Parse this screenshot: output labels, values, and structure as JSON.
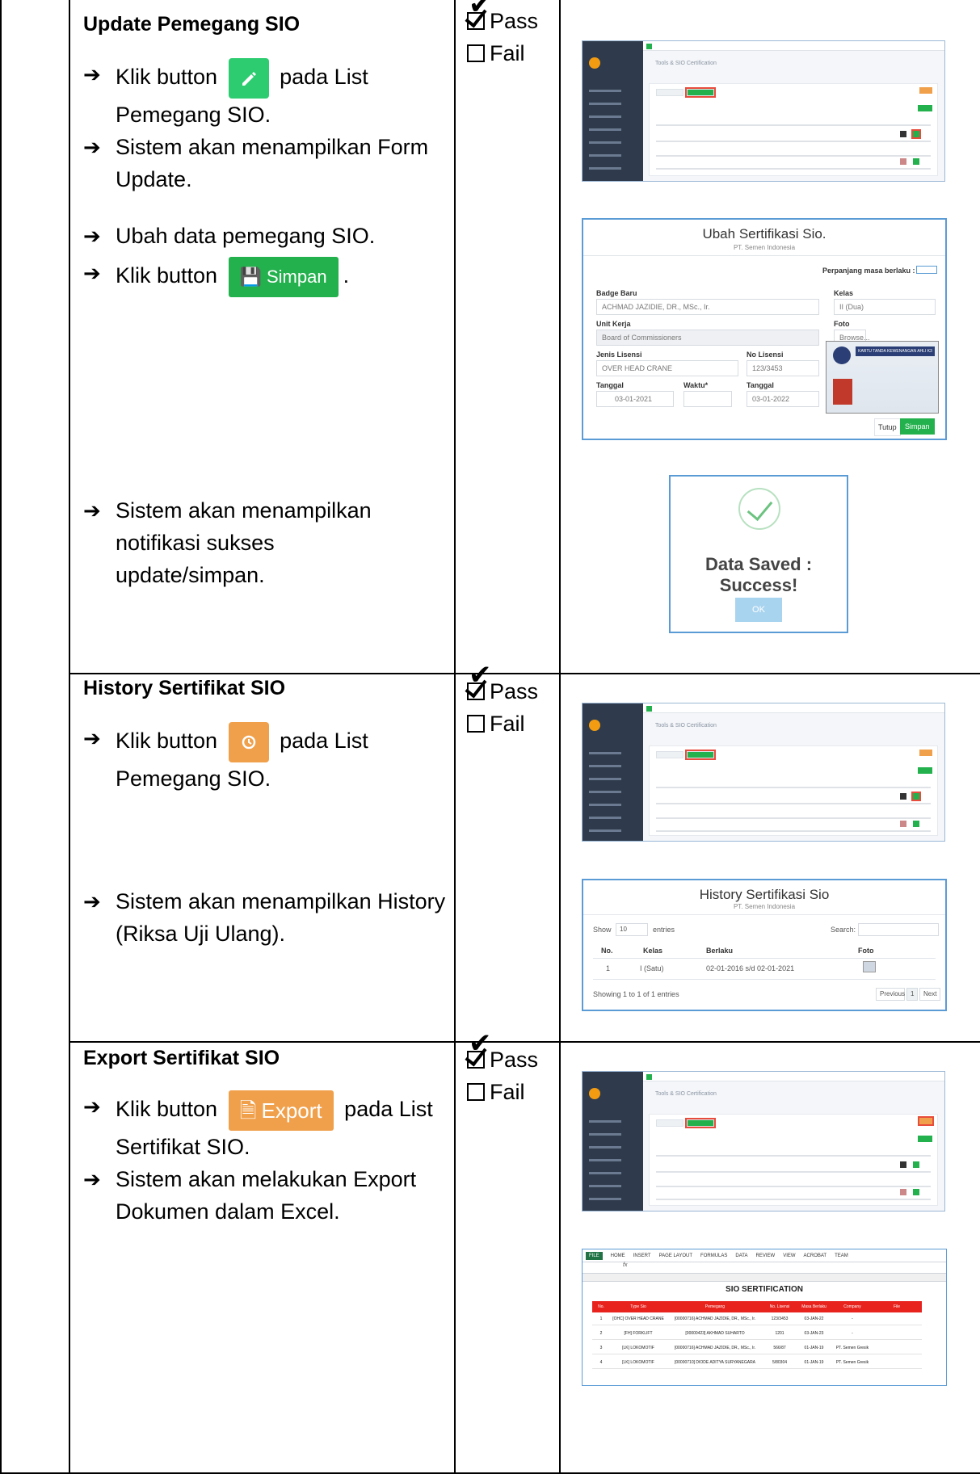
{
  "rows": [
    {
      "title": "Update Pemegang SIO",
      "steps": [
        {
          "pre": "Klik button",
          "post": "pada List Pemegang SIO."
        },
        {
          "text": "Sistem akan menampilkan Form Update."
        },
        {
          "text": "Ubah data pemegang SIO."
        },
        {
          "pre": "Klik button",
          "post": "."
        },
        {
          "text": "Sistem akan menampilkan notifikasi sukses update/simpan."
        }
      ],
      "pass_label": "Pass",
      "fail_label": "Fail",
      "pass_checked": true
    },
    {
      "title": "History Sertifikat SIO",
      "steps": [
        {
          "pre": "Klik button",
          "post": "pada List Pemegang SIO."
        },
        {
          "text": "Sistem akan menampilkan History (Riksa Uji Ulang)."
        }
      ],
      "pass_label": "Pass",
      "fail_label": "Fail",
      "pass_checked": true
    },
    {
      "title": "Export Sertifikat SIO",
      "steps": [
        {
          "pre": "Klik button",
          "post": "pada List Sertifikat SIO."
        },
        {
          "text": "Sistem akan melakukan Export Dokumen dalam Excel."
        }
      ],
      "pass_label": "Pass",
      "fail_label": "Fail",
      "pass_checked": true
    }
  ],
  "buttons": {
    "simpan": "Simpan",
    "export": "Export"
  },
  "app_shot": {
    "page_title": "Tools & SIO Certification"
  },
  "update_modal": {
    "title": "Ubah Sertifikasi Sio.",
    "subtitle": "PT. Semen Indonesia",
    "extend_label": "Perpanjang masa berlaku :",
    "badge_label": "Badge Baru",
    "badge_value": "ACHMAD JAZIDIE, DR., MSc., Ir.",
    "kelas_label": "Kelas",
    "kelas_value": "II (Dua)",
    "unit_label": "Unit Kerja",
    "unit_value": "Board of Commissioners",
    "foto_label": "Foto",
    "foto_value": "Browse...",
    "jenis_label": "Jenis Lisensi",
    "jenis_value": "OVER HEAD CRANE",
    "nolisensi_label": "No Lisensi",
    "nolisensi_value": "123/3453",
    "tanggal_label": "Tanggal",
    "tanggal_value": "03-01-2021",
    "waktu_label": "Waktu*",
    "tanggal2_label": "Tanggal",
    "tanggal2_value": "03-01-2022",
    "card_heading": "KARTU TANDA KEWENANGAN AHLI K3",
    "tutup": "Tutup",
    "simpan": "Simpan"
  },
  "success": {
    "message": "Data Saved : Success!",
    "ok": "OK"
  },
  "history_modal": {
    "title": "History Sertifikasi Sio",
    "subtitle": "PT. Semen Indonesia",
    "show": "Show",
    "entries_count": "10",
    "entries": "entries",
    "search": "Search:",
    "col_no": "No.",
    "col_kelas": "Kelas",
    "col_berlaku": "Berlaku",
    "col_foto": "Foto",
    "row_no": "1",
    "row_kelas": "I (Satu)",
    "row_berlaku": "02-01-2016 s/d 02-01-2021",
    "showing": "Showing 1 to 1 of 1 entries",
    "prev": "Previous",
    "page": "1",
    "next": "Next"
  },
  "excel": {
    "tabs": [
      "FILE",
      "HOME",
      "INSERT",
      "PAGE LAYOUT",
      "FORMULAS",
      "DATA",
      "REVIEW",
      "VIEW",
      "ACROBAT",
      "TEAM"
    ],
    "fx": "fx",
    "title": "SIO SERTIFICATION",
    "headers": [
      "No.",
      "Type Sio",
      "Pemegang",
      "No. Lisensi",
      "Masa Berlaku",
      "Company",
      "File"
    ],
    "rows": [
      [
        "1",
        "[OHC] OVER HEAD CRANE",
        "[00000716] ACHMAD JAZIDIE, DR., MSc., Ir.",
        "123/3453",
        "03-JAN-22",
        "-",
        ""
      ],
      [
        "2",
        "[FH] FORKLIFT",
        "[00000423] AKHMAD SUHARTO",
        "1201",
        "03-JAN-23",
        "-",
        ""
      ],
      [
        "3",
        "[LK] LOKOMOTIF",
        "[00000716] ACHMAD JAZIDIE, DR., MSc., Ir.",
        "566/87",
        "01-JAN-19",
        "PT. Semen Gresik",
        ""
      ],
      [
        "4",
        "[LK] LOKOMOTIF",
        "[00000710] DIODE ADITYA SURYANEGARA",
        "5/80304",
        "01-JAN-19",
        "PT. Semen Gresik",
        ""
      ]
    ]
  }
}
